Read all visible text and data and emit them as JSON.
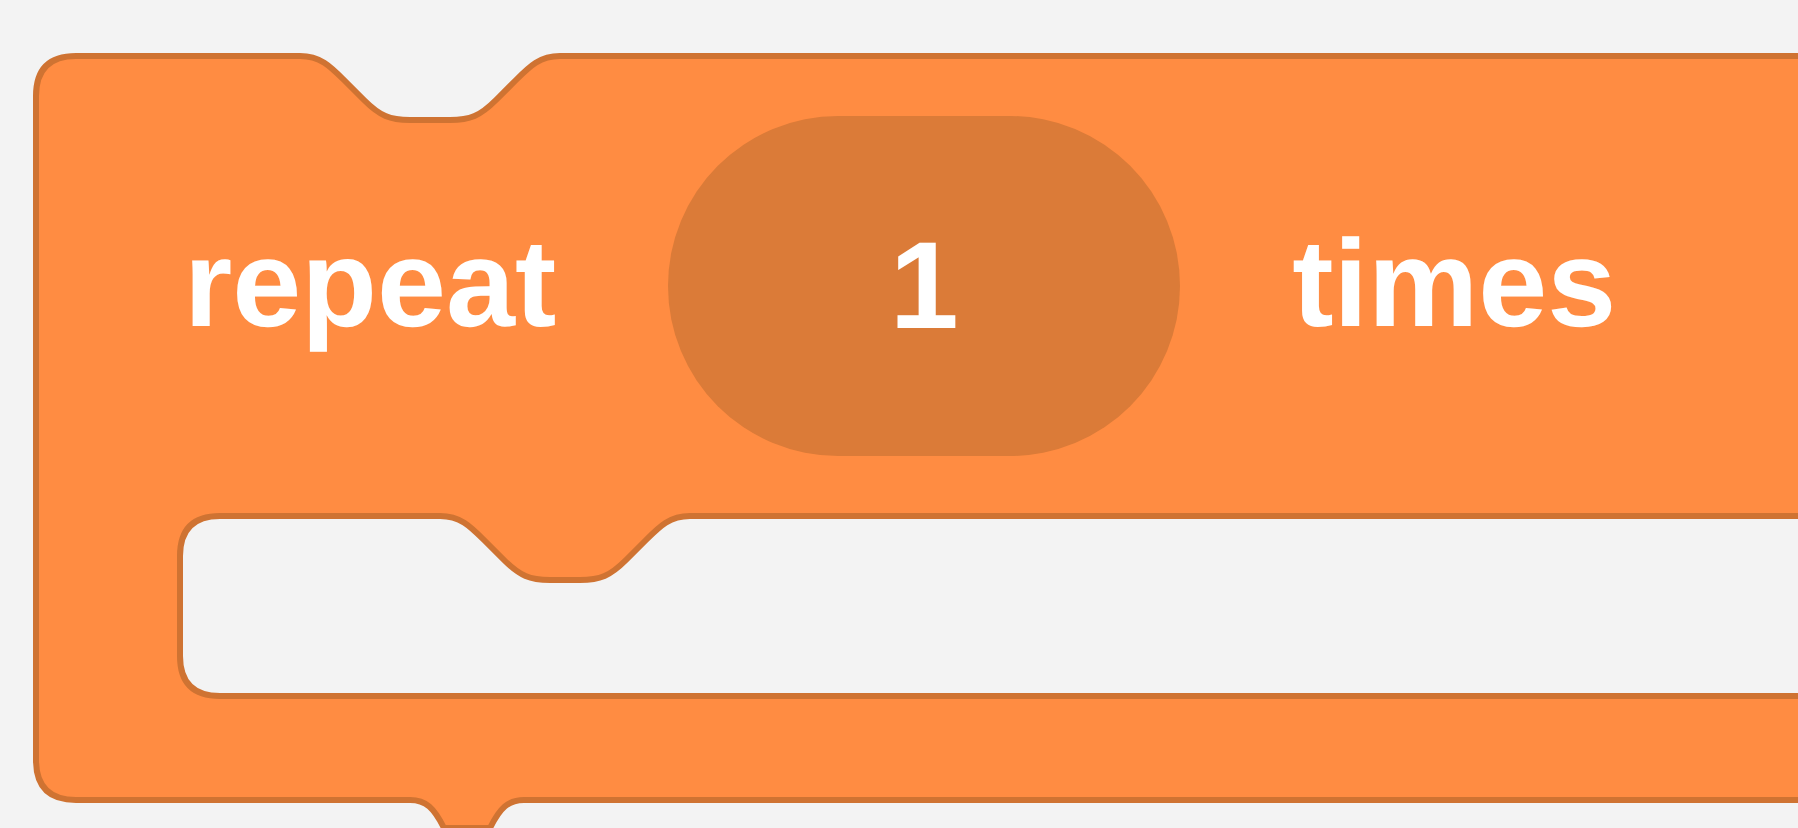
{
  "block": {
    "label": "repeat",
    "count": "1",
    "suffix": "times"
  }
}
